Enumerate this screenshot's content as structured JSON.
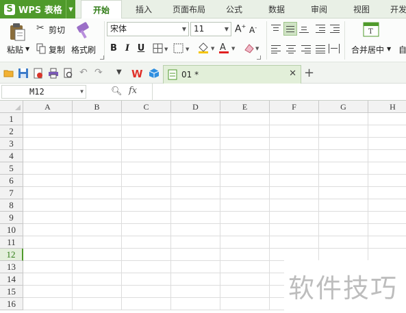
{
  "app": {
    "brand": "WPS 表格",
    "brand_logo": "S"
  },
  "tabs": [
    "开始",
    "插入",
    "页面布局",
    "公式",
    "数据",
    "审阅",
    "视图",
    "开发"
  ],
  "active_tab": "开始",
  "ribbon": {
    "paste": "粘贴",
    "cut": "剪切",
    "copy": "复制",
    "format_painter": "格式刷",
    "font_name": "宋体",
    "font_size": "11",
    "bold": "B",
    "italic": "I",
    "underline": "U",
    "merge_center": "合并居中",
    "wrap": "自"
  },
  "quick_access": {
    "doc_tab": "01 *"
  },
  "formula_bar": {
    "cell_ref": "M12",
    "fx": "fx"
  },
  "sheet": {
    "columns": [
      "A",
      "B",
      "C",
      "D",
      "E",
      "F",
      "G",
      "H"
    ],
    "rows": [
      "1",
      "2",
      "3",
      "4",
      "5",
      "6",
      "7",
      "8",
      "9",
      "10",
      "11",
      "12",
      "13",
      "14",
      "15",
      "16"
    ],
    "active_row": "12"
  },
  "watermark": "软件技巧",
  "colors": {
    "brand_green": "#4f9a2b",
    "active_tab_text": "#2d7a12",
    "tabbar_bg": "#e9f0e6",
    "doc_tab_bg": "#e2efd9"
  }
}
